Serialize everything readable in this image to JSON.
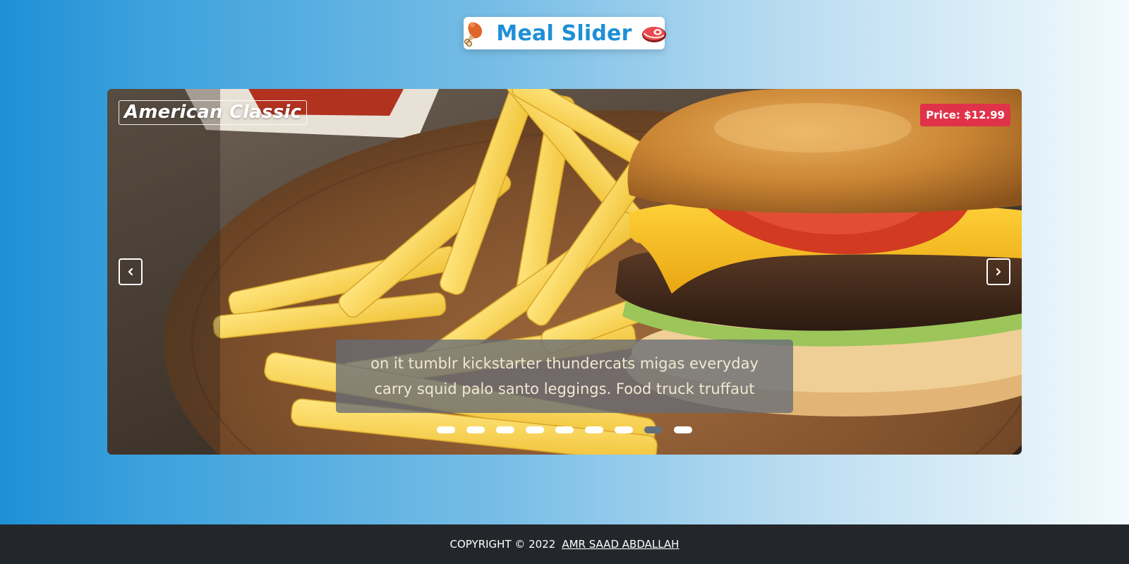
{
  "header": {
    "title": "Meal Slider",
    "left_icon": "drumstick-icon",
    "right_icon": "meat-steak-icon"
  },
  "slide": {
    "title": "American Classic",
    "price": "Price: $12.99",
    "description": "on it tumblr kickstarter thundercats migas everyday carry squid palo santo leggings. Food truck truffaut",
    "image": "burger-and-fries-photo"
  },
  "controls": {
    "prev_icon": "chevron-left-icon",
    "next_icon": "chevron-right-icon",
    "dots_total": 9,
    "active_dot_index": 7
  },
  "footer": {
    "copyright": "COPYRIGHT © 2022",
    "author": "AMR SAAD ABDALLAH"
  },
  "colors": {
    "accent": "#1e8fd6",
    "price_badge": "#e0334a",
    "footer_bg": "#23272b",
    "active_dot": "#63707c"
  }
}
